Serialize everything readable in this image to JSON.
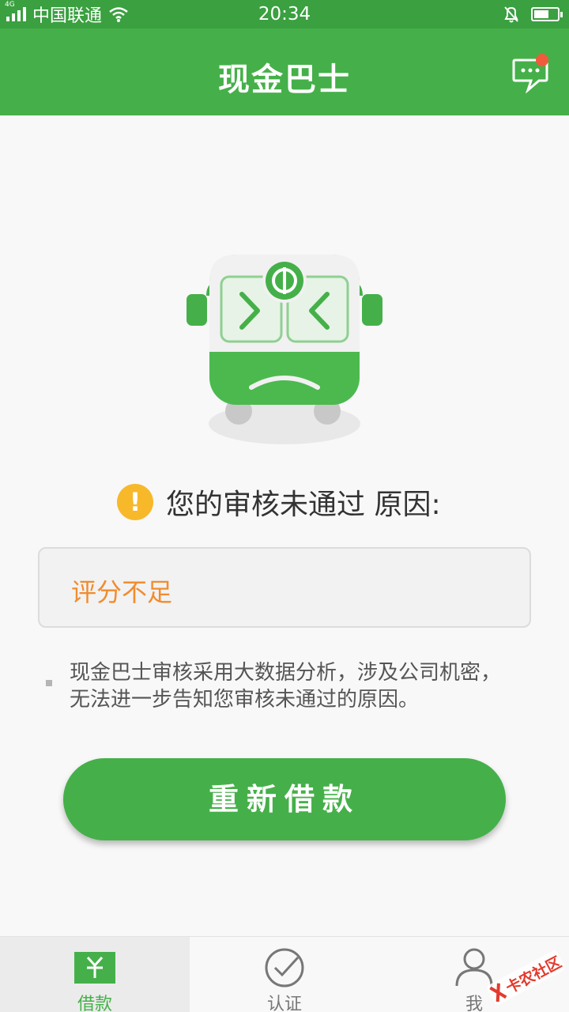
{
  "status_bar": {
    "network": "4G",
    "carrier": "中国联通",
    "time": "20:34"
  },
  "header": {
    "title": "现金巴士",
    "message_icon": "chat-bubble-icon"
  },
  "result": {
    "heading": "您的审核未通过 原因:",
    "reason": "评分不足",
    "note": "现金巴士审核采用大数据分析，涉及公司机密，无法进一步告知您审核未通过的原因。"
  },
  "action": {
    "button_label": "重新借款"
  },
  "tabs": [
    {
      "label": "借款",
      "icon": "yuan-card-icon",
      "active": true
    },
    {
      "label": "认证",
      "icon": "check-circle-icon",
      "active": false
    },
    {
      "label": "我",
      "icon": "person-icon",
      "active": false
    }
  ],
  "watermark": "卡农社区",
  "colors": {
    "primary": "#45b049",
    "reason_text": "#f18c2e",
    "warning": "#f7b82a",
    "badge": "#ef5b3c"
  }
}
